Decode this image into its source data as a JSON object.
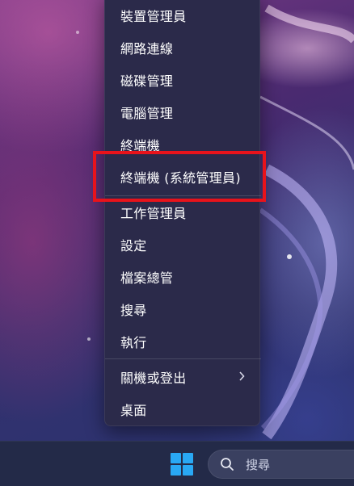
{
  "context_menu": {
    "items": [
      {
        "label": "裝置管理員"
      },
      {
        "label": "網路連線"
      },
      {
        "label": "磁碟管理"
      },
      {
        "label": "電腦管理"
      },
      {
        "label": "終端機"
      },
      {
        "label": "終端機 (系統管理員)"
      },
      {
        "label": "工作管理員"
      },
      {
        "label": "設定"
      },
      {
        "label": "檔案總管"
      },
      {
        "label": "搜尋"
      },
      {
        "label": "執行"
      },
      {
        "label": "關機或登出",
        "submenu": true
      },
      {
        "label": "桌面"
      }
    ],
    "highlighted_item": "終端機 (系統管理員)",
    "highlight_color": "#e8131b"
  },
  "taskbar": {
    "start_icon": "windows-logo-icon",
    "search": {
      "icon": "search-icon",
      "label": "搜尋"
    },
    "accent_color": "#29a8f4"
  }
}
